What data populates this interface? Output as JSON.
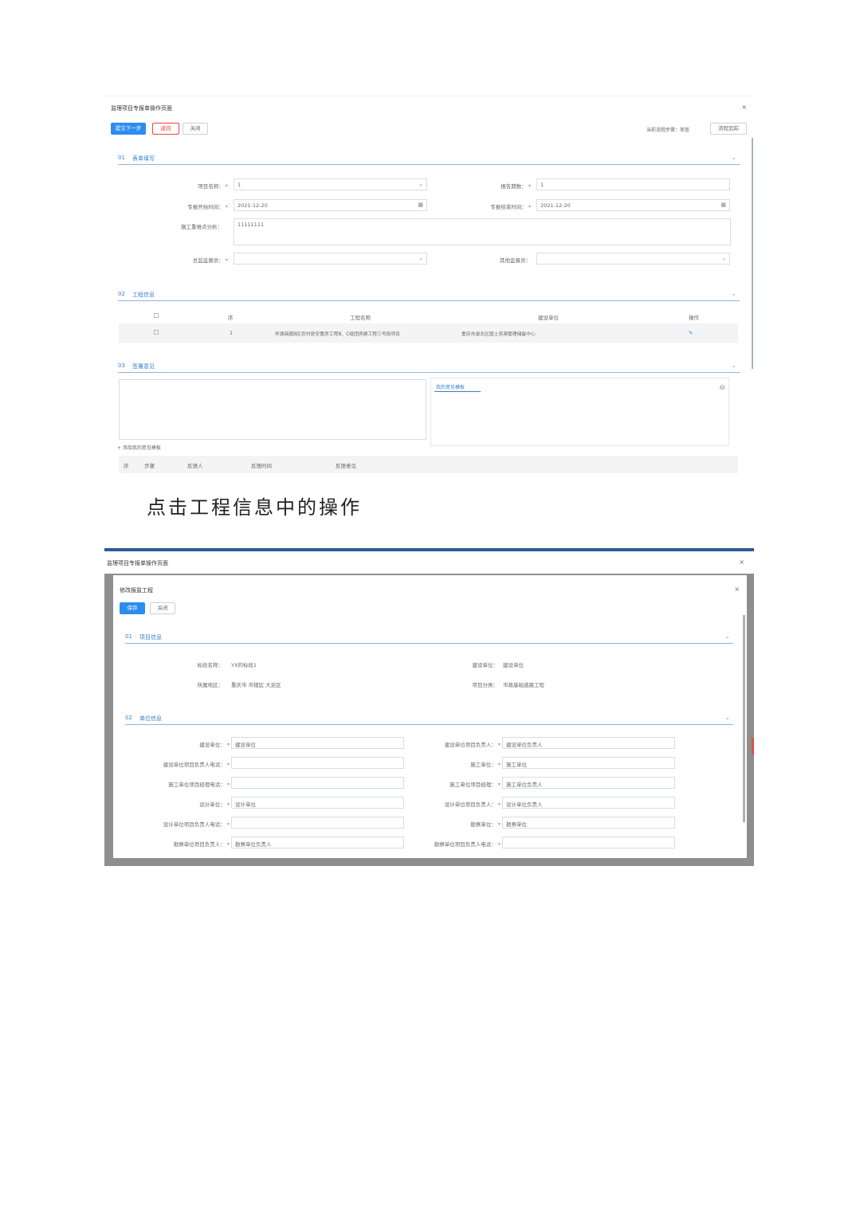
{
  "shot1": {
    "title": "监理项目专报单操作页面",
    "close": "×",
    "buttons": {
      "next": "提交下一步",
      "back": "返回",
      "close": "关闭"
    },
    "flow_label": "当前流程步骤：审查",
    "flow_button": "流程追踪",
    "section1": {
      "num": "01",
      "title": "表单填写",
      "chevron": "⌄"
    },
    "fields": {
      "project_name_label": "项目名称：",
      "project_name_value": "1",
      "report_count_label": "报告期数：",
      "report_count_value": "1",
      "start_time_label": "专报开始时间：",
      "start_time_value": "2021-12-20",
      "end_time_label": "专报结束时间：",
      "end_time_value": "2021-12-20",
      "analysis_label": "施工重难点分析：",
      "analysis_value": "11111111",
      "chief_label": "总监监督员：",
      "other_label": "其他监督员："
    },
    "section2": {
      "num": "02",
      "title": "工程信息",
      "chevron": "⌄"
    },
    "table": {
      "headers": [
        "序",
        "工程名称",
        "建设单位",
        "操作"
      ],
      "rows": [
        {
          "index": "1",
          "name": "怀湖商圈B区农村居安置房工程B、C组团房建工程三号段项目",
          "unit": "重庆市渝北区国土资源管理储备中心",
          "action": "✎"
        }
      ]
    },
    "section3": {
      "num": "03",
      "title": "签署意见",
      "chevron": "⌄"
    },
    "opinion_tab": "我的意见模板",
    "add_template": "+ 添加我的意见模板",
    "history_headers": [
      "序",
      "步骤",
      "反馈人",
      "反馈时间",
      "反馈意见"
    ]
  },
  "caption": "点击工程信息中的操作",
  "shot2": {
    "window_title": "监理项目专报单操作页面",
    "window_close": "×",
    "dialog_title": "修改报监工程",
    "dialog_close": "×",
    "buttons": {
      "save": "保存",
      "close": "关闭"
    },
    "section1": {
      "num": "01",
      "title": "项目信息",
      "chevron": "⌄"
    },
    "info": {
      "bid_name_label": "标段名称：",
      "bid_name_value": "YX的标段1",
      "build_unit_label": "建设单位：",
      "build_unit_value": "建设单位",
      "region_label": "所属地区：",
      "region_value": "重庆市 市辖区 大足区",
      "category_label": "项目分类：",
      "category_value": "市政基础道路工程"
    },
    "section2": {
      "num": "02",
      "title": "单位信息",
      "chevron": "⌄"
    },
    "unit_fields": [
      {
        "left_label": "建设单位：",
        "left_value": "建设单位",
        "right_label": "建设单位项目负责人：",
        "right_value": "建设单位负责人"
      },
      {
        "left_label": "建设单位项目负责人电话：",
        "left_value": "",
        "right_label": "施工单位：",
        "right_value": "施工单位"
      },
      {
        "left_label": "施工单位项目经理电话：",
        "left_value": "",
        "right_label": "施工单位项目经理：",
        "right_value": "施工单位负责人"
      },
      {
        "left_label": "设计单位：",
        "left_value": "设计单位",
        "right_label": "设计单位项目负责人：",
        "right_value": "设计单位负责人"
      },
      {
        "left_label": "设计单位项目负责人电话：",
        "left_value": "",
        "right_label": "勘察单位：",
        "right_value": "勘察单位"
      },
      {
        "left_label": "勘察单位项目负责人：",
        "left_value": "勘察单位负责人",
        "right_label": "勘察单位项目负责人电话：",
        "right_value": ""
      }
    ]
  }
}
